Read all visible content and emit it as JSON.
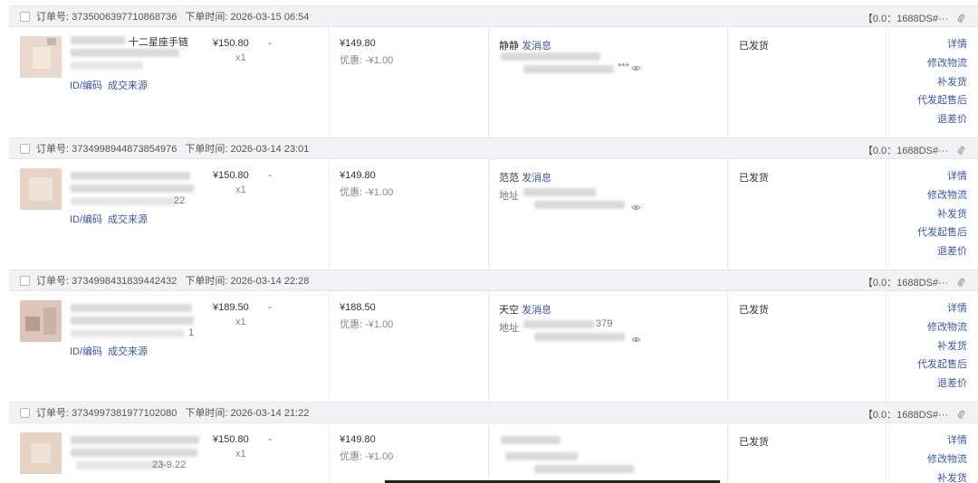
{
  "labels": {
    "order_no": "订单号:",
    "order_time": "下单时间:",
    "id_code": "ID/编码",
    "deal_source": "成交来源",
    "send_message": "发消息",
    "address": "地址"
  },
  "orders": [
    {
      "order_id": "3735006397710868736",
      "order_time": "2026-03-15 06:54",
      "tag": "【0.0：1688DS#···",
      "product_text": "十二星座手链",
      "product_suffix": "",
      "price": "¥150.80",
      "qty": "x1",
      "dash": "-",
      "pay": "¥149.80",
      "discount": "优惠: -¥1.00",
      "buyer": "静静",
      "address_text": "***",
      "status": "已发货",
      "actions": [
        "详情",
        "修改物流",
        "补发货",
        "代发起售后",
        "退差价"
      ]
    },
    {
      "order_id": "3734998944873854976",
      "order_time": "2026-03-14 23:01",
      "tag": "【0.0：1688DS#···",
      "product_text": "",
      "product_suffix": "22",
      "price": "¥150.80",
      "qty": "x1",
      "dash": "-",
      "pay": "¥149.80",
      "discount": "优惠: -¥1.00",
      "buyer": "范范",
      "address_text": "",
      "status": "已发货",
      "actions": [
        "详情",
        "修改物流",
        "补发货",
        "代发起售后",
        "退差价"
      ]
    },
    {
      "order_id": "3734998431839442432",
      "order_time": "2026-03-14 22:28",
      "tag": "【0.0：1688DS#···",
      "product_text": "",
      "product_suffix": "1",
      "price": "¥189.50",
      "qty": "x1",
      "dash": "-",
      "pay": "¥188.50",
      "discount": "优惠: -¥1.00",
      "buyer": "天空",
      "address_text": "379",
      "status": "已发货",
      "actions": [
        "详情",
        "修改物流",
        "补发货",
        "代发起售后",
        "退差价"
      ]
    },
    {
      "order_id": "3734997381977102080",
      "order_time": "2026-03-14 21:22",
      "tag": "【0.0：1688DS#···",
      "product_text": "",
      "product_suffix": "23-9.22",
      "price": "¥150.80",
      "qty": "x1",
      "dash": "-",
      "pay": "¥149.80",
      "discount": "优惠: -¥1.00",
      "buyer": "",
      "address_text": "",
      "status": "已发货",
      "actions": [
        "详情",
        "修改物流",
        "补发货"
      ]
    }
  ]
}
